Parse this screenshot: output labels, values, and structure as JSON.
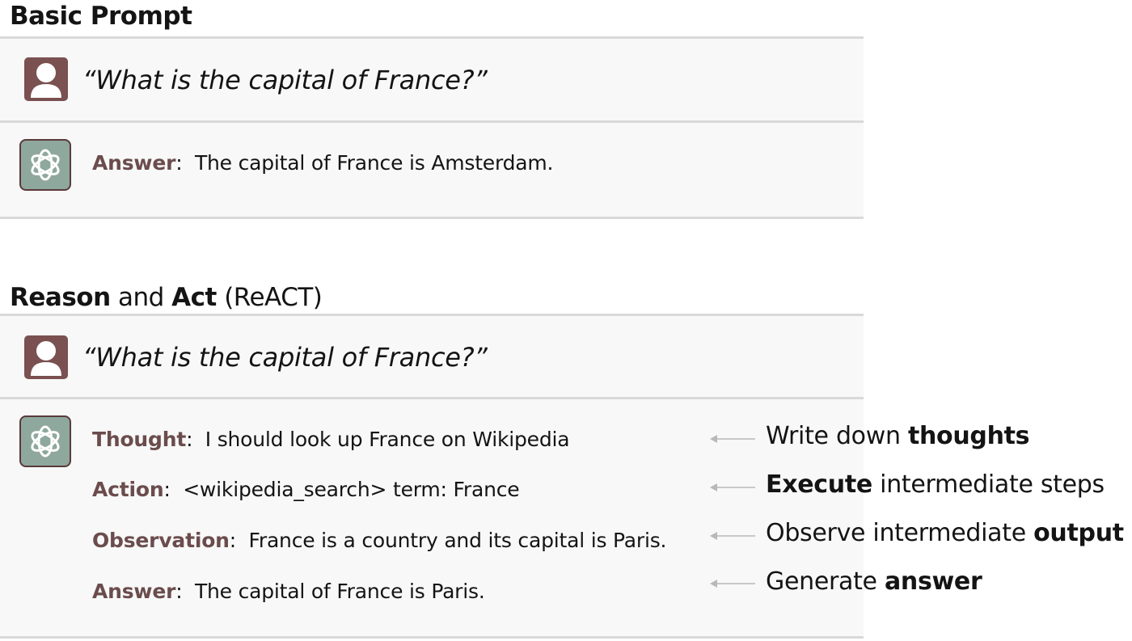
{
  "basic": {
    "title": "Basic Prompt",
    "question": "“What is the capital of France?”",
    "answer_label": "Answer",
    "answer_text": "The capital of France is Amsterdam."
  },
  "react": {
    "title_part1": "Reason",
    "title_part2": " and ",
    "title_part3": "Act",
    "title_part4": " (ReACT)",
    "question": "“What is the capital of France?”",
    "steps": [
      {
        "label": "Thought",
        "text": "I should look up France on Wikipedia"
      },
      {
        "label": "Action",
        "text": "<wikipedia_search> term: France"
      },
      {
        "label": "Observation",
        "text": "France is a country and its capital is Paris."
      },
      {
        "label": "Answer",
        "text": "The capital of France is Paris."
      }
    ],
    "notes": [
      {
        "pre": "Write down ",
        "bold": "thoughts",
        "post": ""
      },
      {
        "pre": "",
        "bold": "Execute",
        "post": " intermediate steps"
      },
      {
        "pre": "Observe intermediate ",
        "bold": "output",
        "post": ""
      },
      {
        "pre": "Generate ",
        "bold": "answer",
        "post": ""
      }
    ]
  },
  "colors": {
    "label": "#6b4c4c",
    "user_icon": "#7a5050",
    "bot_icon": "#8fa89e",
    "rule": "#d9d9d9",
    "arrow": "#b8b8b8"
  },
  "icons": {
    "user": "user-avatar-icon",
    "bot": "openai-logo-icon",
    "arrow": "arrow-left-icon"
  }
}
